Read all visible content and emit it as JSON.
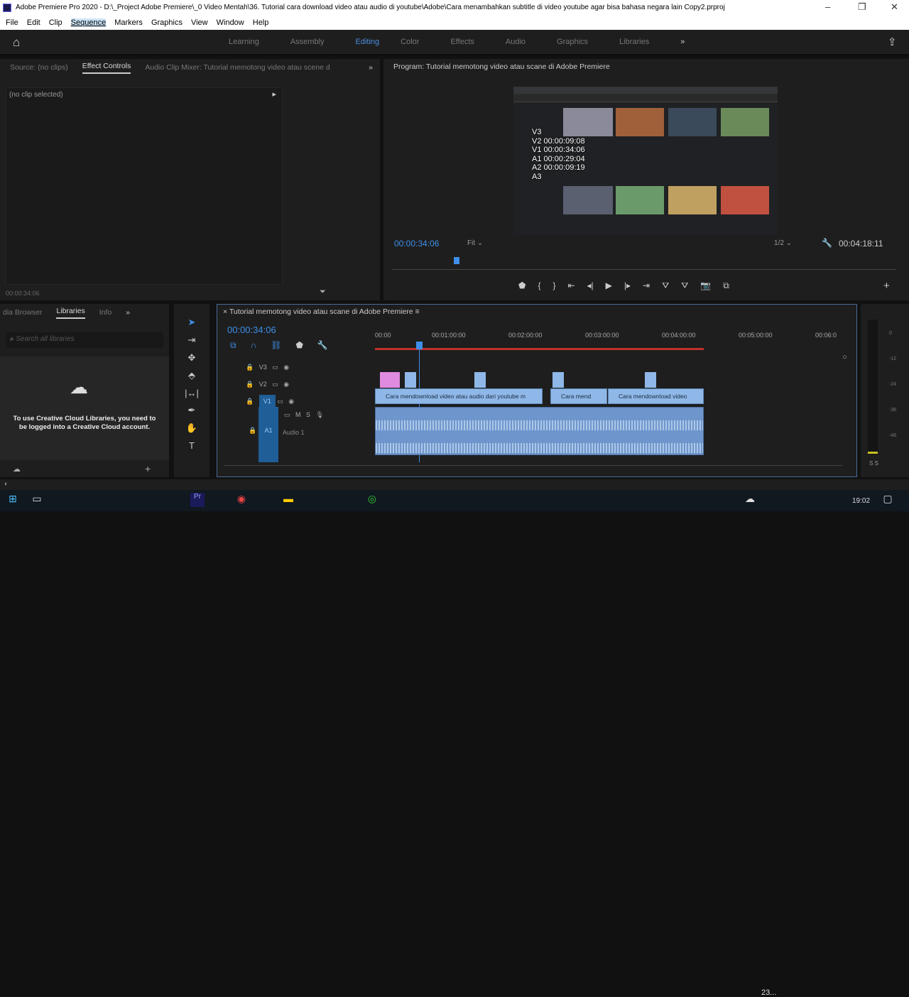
{
  "window": {
    "title": "Adobe Premiere Pro 2020 - D:\\_Project Adobe Premiere\\_0 Video Mentah\\36. Tutorial cara download video atau audio di youtube\\Adobe\\Cara menambahkan subtitle di video youtube agar bisa bahasa negara lain Copy2.prproj",
    "minimize": "–",
    "restore": "❐",
    "close": "✕"
  },
  "menu": [
    "File",
    "Edit",
    "Clip",
    "Sequence",
    "Markers",
    "Graphics",
    "View",
    "Window",
    "Help"
  ],
  "workspaces": [
    "Learning",
    "Assembly",
    "Editing",
    "Color",
    "Effects",
    "Audio",
    "Graphics",
    "Libraries"
  ],
  "source_panel": {
    "tabs": [
      "Source: (no clips)",
      "Effect Controls",
      "Audio Clip Mixer: Tutorial memotong video atau scene d"
    ],
    "no_clip": "(no clip selected)",
    "timecode": "00:00:34:06"
  },
  "program": {
    "title": "Program: Tutorial memotong video atau scane di Adobe Premiere",
    "timecode": "00:00:34:06",
    "fit": "Fit",
    "quality": "1/2",
    "duration": "00:04:18:11",
    "overlay": [
      "V3",
      "V2 00:00:09:08",
      "V1 00:00:34:06",
      "A1 00:00:29:04",
      "A2 00:00:09:19",
      "A3"
    ]
  },
  "libraries": {
    "tabs": [
      "dia Browser",
      "Libraries",
      "Info"
    ],
    "search_placeholder": "Search all libraries",
    "message": "To use Creative Cloud Libraries, you need to be logged into a Creative Cloud account."
  },
  "timeline": {
    "title": "Tutorial memotong video atau scane di Adobe Premiere",
    "timecode": "00:00:34:06",
    "ruler": [
      "00:00",
      "00:01:00:00",
      "00:02:00:00",
      "00:03:00:00",
      "00:04:00:00",
      "00:05:00:00",
      "00:06:0"
    ],
    "tracks": {
      "v3": "V3",
      "v2": "V2",
      "v1": "V1",
      "a1": "A1",
      "a1_name": "Audio 1",
      "m": "M",
      "s": "S"
    },
    "clips": [
      "Cara mendownload video atau audio dari youtube m",
      "Cara mend",
      "Cara mendownload video"
    ]
  },
  "meter": {
    "labels": [
      "0",
      "-12",
      "-24",
      "-36",
      "-48"
    ],
    "solo": "S S"
  },
  "taskbar": {
    "time": "19:02",
    "weather": "23..."
  }
}
